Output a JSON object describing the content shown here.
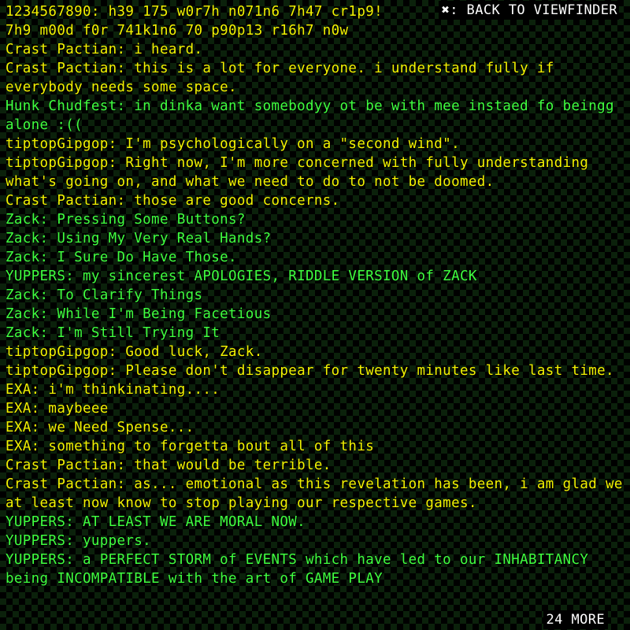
{
  "nav": {
    "back_label": "✖: BACK TO VIEWFINDER",
    "more_label": "24 MORE"
  },
  "colors": {
    "yellow": "#f2f200",
    "green": "#3fff3f"
  },
  "messages": [
    {
      "color": "yellow",
      "text": "1234567890: h39 175 w0r7h n071n6 7h47 cr1p9! 7h9 m00d f0r 741k1n6 70 p90p13 r16h7 n0w"
    },
    {
      "color": "yellow",
      "text": "Crast Pactian: i heard."
    },
    {
      "color": "yellow",
      "text": "Crast Pactian: this is a lot for everyone. i understand fully if everybody needs some space."
    },
    {
      "color": "green",
      "text": "Hunk Chudfest: in dinka want somebodyy ot be with mee instaed fo beingg alone :(("
    },
    {
      "color": "yellow",
      "text": "tiptopGipgop: I'm psychologically on a \"second wind\"."
    },
    {
      "color": "yellow",
      "text": "tiptopGipgop: Right now, I'm more concerned with fully understanding what's going on, and what we need to do to not be doomed."
    },
    {
      "color": "yellow",
      "text": "Crast Pactian: those are good concerns."
    },
    {
      "color": "green",
      "text": "Zack: Pressing Some Buttons?"
    },
    {
      "color": "green",
      "text": "Zack: Using My Very Real Hands?"
    },
    {
      "color": "green",
      "text": "Zack: I Sure Do Have Those."
    },
    {
      "color": "green",
      "text": "YUPPERS: my sincerest APOLOGIES, RIDDLE VERSION of ZACK"
    },
    {
      "color": "green",
      "text": "Zack: To Clarify Things"
    },
    {
      "color": "green",
      "text": "Zack: While I'm Being Facetious"
    },
    {
      "color": "green",
      "text": "Zack: I'm Still Trying It"
    },
    {
      "color": "yellow",
      "text": "tiptopGipgop: Good luck, Zack."
    },
    {
      "color": "yellow",
      "text": "tiptopGipgop: Please don't disappear for twenty minutes like last time."
    },
    {
      "color": "yellow",
      "text": "EXA: i'm thinkinating...."
    },
    {
      "color": "yellow",
      "text": "EXA: maybeee"
    },
    {
      "color": "yellow",
      "text": "EXA: we Need Spense..."
    },
    {
      "color": "yellow",
      "text": "EXA: something to forgetta bout all of this"
    },
    {
      "color": "yellow",
      "text": "Crast Pactian: that would be terrible."
    },
    {
      "color": "yellow",
      "text": "Crast Pactian: as... emotional as this revelation has been, i am glad we at least now know to stop playing our respective games."
    },
    {
      "color": "green",
      "text": "YUPPERS: AT LEAST WE ARE MORAL NOW."
    },
    {
      "color": "green",
      "text": "YUPPERS: yuppers."
    },
    {
      "color": "green",
      "text": "YUPPERS: a PERFECT STORM of EVENTS which have led to our INHABITANCY being INCOMPATIBLE with the art of GAME PLAY"
    }
  ]
}
